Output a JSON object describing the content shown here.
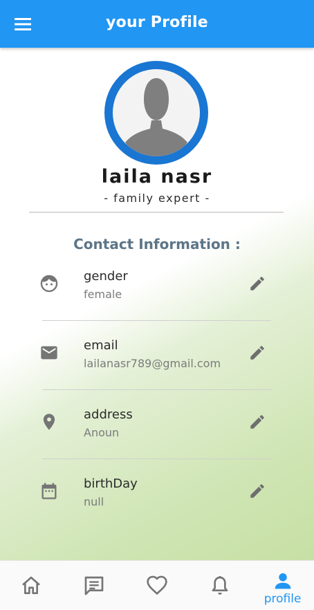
{
  "app_bar": {
    "title": "your Profile",
    "menu_icon": "menu-icon",
    "background": "#2196f3"
  },
  "profile": {
    "name": "laila nasr",
    "role": "- family expert -",
    "avatar_ring_color": "#1976d2"
  },
  "contact": {
    "title": "Contact Information :",
    "items": [
      {
        "icon": "face-icon",
        "label": "gender",
        "value": "female",
        "action_icon": "edit-icon"
      },
      {
        "icon": "email-icon",
        "label": "email",
        "value": "lailanasr789@gmail.com",
        "action_icon": "edit-icon"
      },
      {
        "icon": "location-icon",
        "label": "address",
        "value": "Anoun",
        "action_icon": "edit-icon"
      },
      {
        "icon": "calendar-icon",
        "label": "birthDay",
        "value": "null",
        "action_icon": "edit-icon"
      }
    ]
  },
  "bottom_nav": {
    "active_color": "#2196f3",
    "items": [
      {
        "icon": "home-icon",
        "label": ""
      },
      {
        "icon": "chat-icon",
        "label": ""
      },
      {
        "icon": "heart-icon",
        "label": ""
      },
      {
        "icon": "bell-icon",
        "label": ""
      },
      {
        "icon": "person-icon",
        "label": "profile",
        "active": true
      }
    ]
  }
}
